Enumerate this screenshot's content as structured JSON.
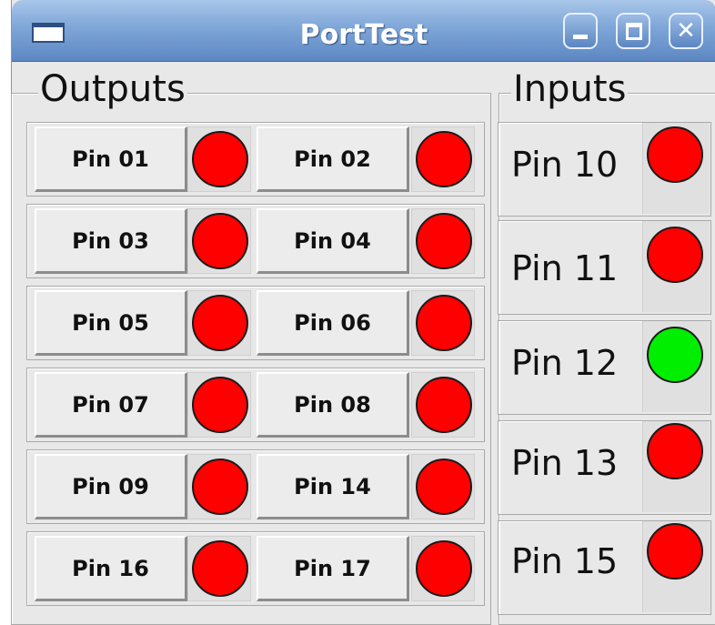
{
  "window": {
    "title": "PortTest",
    "controls": {
      "close_glyph": "✕"
    }
  },
  "outputs": {
    "legend": "Outputs",
    "rows": [
      [
        {
          "label": "Pin 01",
          "state": "off"
        },
        {
          "label": "Pin 02",
          "state": "off"
        }
      ],
      [
        {
          "label": "Pin 03",
          "state": "off"
        },
        {
          "label": "Pin 04",
          "state": "off"
        }
      ],
      [
        {
          "label": "Pin 05",
          "state": "off"
        },
        {
          "label": "Pin 06",
          "state": "off"
        }
      ],
      [
        {
          "label": "Pin 07",
          "state": "off"
        },
        {
          "label": "Pin 08",
          "state": "off"
        }
      ],
      [
        {
          "label": "Pin 09",
          "state": "off"
        },
        {
          "label": "Pin 14",
          "state": "off"
        }
      ],
      [
        {
          "label": "Pin 16",
          "state": "off"
        },
        {
          "label": "Pin 17",
          "state": "off"
        }
      ]
    ]
  },
  "inputs": {
    "legend": "Inputs",
    "items": [
      {
        "label": "Pin 10",
        "state": "off"
      },
      {
        "label": "Pin 11",
        "state": "off"
      },
      {
        "label": "Pin 12",
        "state": "on"
      },
      {
        "label": "Pin 13",
        "state": "off"
      },
      {
        "label": "Pin 15",
        "state": "off"
      }
    ]
  },
  "colors": {
    "led_on": "#00ee00",
    "led_off": "#ff0000"
  }
}
